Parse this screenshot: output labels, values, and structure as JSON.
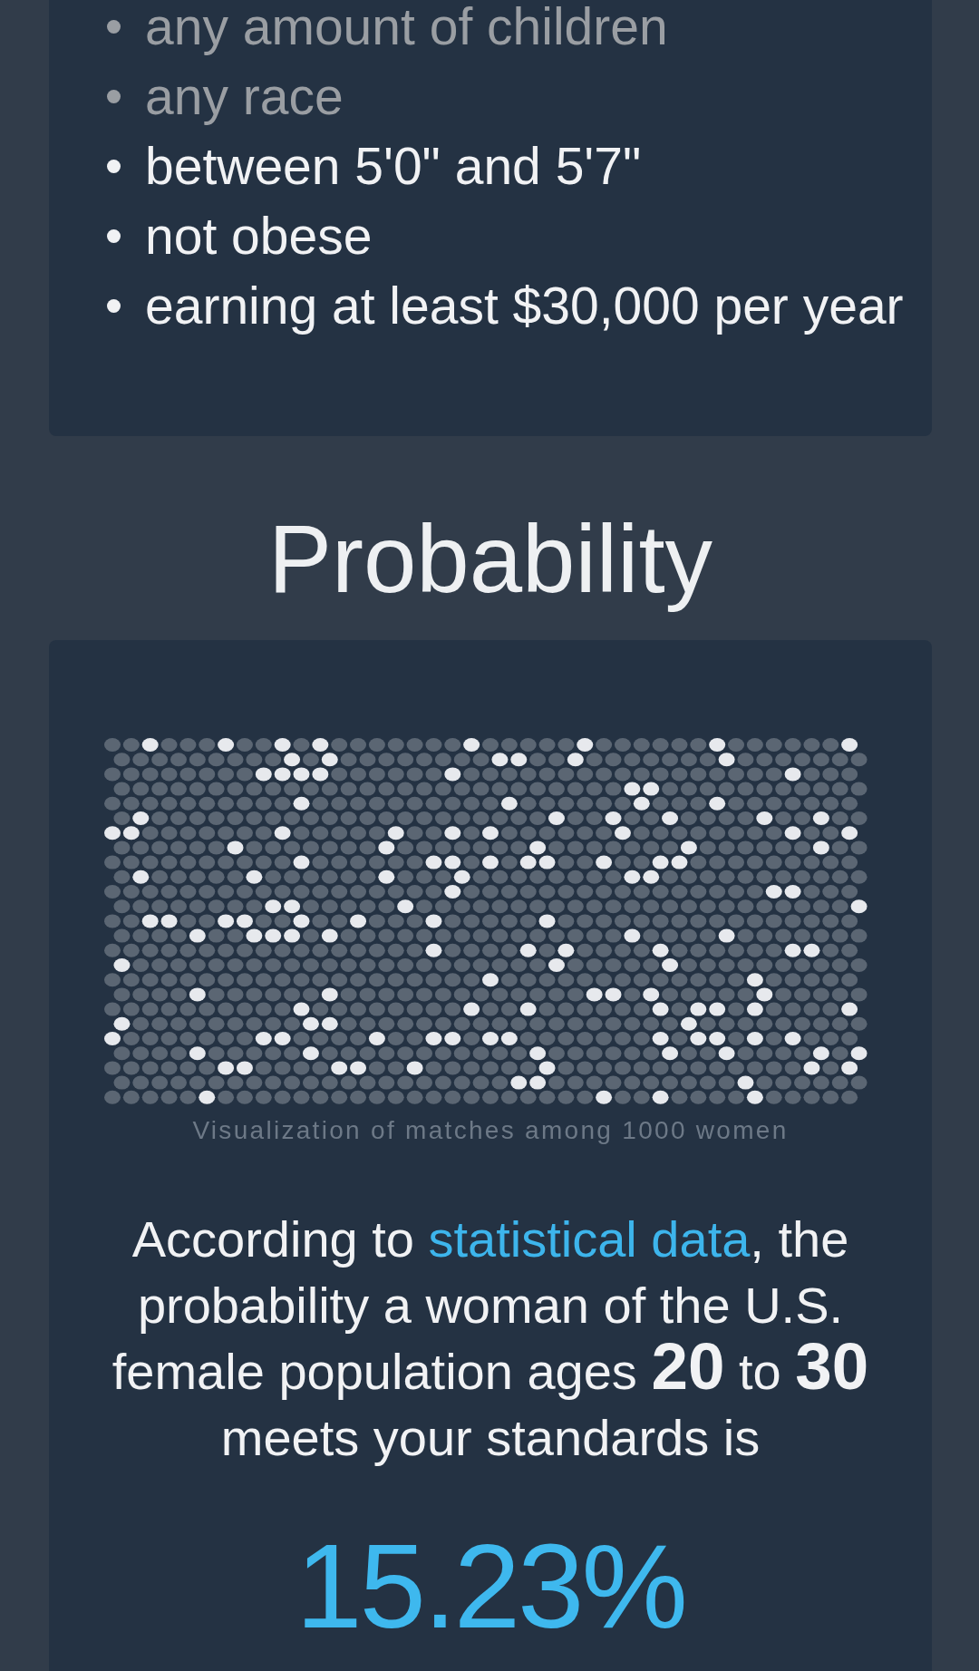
{
  "criteria": {
    "items": [
      {
        "text": "any amount of children",
        "dimmed": true
      },
      {
        "text": "any race",
        "dimmed": true
      },
      {
        "text": "between 5'0\" and 5'7\"",
        "dimmed": false
      },
      {
        "text": "not obese",
        "dimmed": false
      },
      {
        "text": "earning at least $30,000 per year",
        "dimmed": false
      }
    ]
  },
  "probability": {
    "heading": "Probability",
    "dot_rows": [
      [
        false,
        false,
        true,
        false,
        false,
        false,
        true,
        false,
        false,
        true,
        false,
        true,
        false,
        false,
        false,
        false,
        false,
        false,
        false,
        true,
        false,
        false,
        false,
        false,
        false,
        true,
        false,
        false,
        false,
        false,
        false,
        false,
        true,
        false,
        false,
        false,
        false,
        false,
        false,
        true
      ],
      [
        false,
        false,
        false,
        false,
        false,
        false,
        false,
        false,
        false,
        true,
        false,
        true,
        false,
        false,
        false,
        false,
        false,
        false,
        false,
        false,
        true,
        true,
        false,
        false,
        true,
        false,
        false,
        false,
        false,
        false,
        false,
        false,
        true,
        false,
        false,
        false,
        false,
        false,
        false,
        false
      ],
      [
        false,
        false,
        false,
        false,
        false,
        false,
        false,
        false,
        true,
        true,
        true,
        true,
        false,
        false,
        false,
        false,
        false,
        false,
        true,
        false,
        false,
        false,
        false,
        false,
        false,
        false,
        false,
        false,
        false,
        false,
        false,
        false,
        false,
        false,
        false,
        false,
        true,
        false,
        false,
        false
      ],
      [
        false,
        false,
        false,
        false,
        false,
        false,
        false,
        false,
        false,
        false,
        false,
        false,
        false,
        false,
        false,
        false,
        false,
        false,
        false,
        false,
        false,
        false,
        false,
        false,
        false,
        false,
        false,
        true,
        true,
        false,
        false,
        false,
        false,
        false,
        false,
        false,
        false,
        false,
        false,
        false
      ],
      [
        false,
        false,
        false,
        false,
        false,
        false,
        false,
        false,
        false,
        false,
        true,
        false,
        false,
        false,
        false,
        false,
        false,
        false,
        false,
        false,
        false,
        true,
        false,
        false,
        false,
        false,
        false,
        false,
        true,
        false,
        false,
        false,
        true,
        false,
        false,
        false,
        false,
        false,
        false,
        false
      ],
      [
        false,
        true,
        false,
        false,
        false,
        false,
        false,
        false,
        false,
        false,
        false,
        false,
        false,
        false,
        false,
        false,
        false,
        false,
        false,
        false,
        false,
        false,
        false,
        true,
        false,
        false,
        true,
        false,
        false,
        true,
        false,
        false,
        false,
        false,
        true,
        false,
        false,
        true,
        false,
        false
      ],
      [
        true,
        true,
        false,
        false,
        false,
        false,
        false,
        false,
        false,
        true,
        false,
        false,
        false,
        false,
        false,
        true,
        false,
        false,
        true,
        false,
        true,
        false,
        false,
        false,
        false,
        false,
        false,
        true,
        false,
        false,
        false,
        false,
        false,
        false,
        false,
        false,
        true,
        false,
        false,
        true
      ],
      [
        false,
        false,
        false,
        false,
        false,
        false,
        true,
        false,
        false,
        false,
        false,
        false,
        false,
        false,
        true,
        false,
        false,
        false,
        false,
        false,
        false,
        false,
        true,
        false,
        false,
        false,
        false,
        false,
        false,
        false,
        true,
        false,
        false,
        false,
        false,
        false,
        false,
        true,
        false,
        false
      ],
      [
        false,
        false,
        false,
        false,
        false,
        false,
        false,
        false,
        false,
        false,
        true,
        false,
        false,
        false,
        false,
        false,
        false,
        true,
        true,
        false,
        true,
        false,
        true,
        true,
        false,
        false,
        true,
        false,
        false,
        true,
        true,
        false,
        false,
        false,
        false,
        false,
        false,
        false,
        false,
        false
      ],
      [
        false,
        true,
        false,
        false,
        false,
        false,
        false,
        true,
        false,
        false,
        false,
        false,
        false,
        false,
        true,
        false,
        false,
        false,
        true,
        false,
        false,
        false,
        false,
        false,
        false,
        false,
        false,
        true,
        true,
        false,
        false,
        false,
        false,
        false,
        false,
        false,
        false,
        false,
        false,
        false
      ],
      [
        false,
        false,
        false,
        false,
        false,
        false,
        false,
        false,
        false,
        false,
        false,
        false,
        false,
        false,
        false,
        false,
        false,
        false,
        true,
        false,
        false,
        false,
        false,
        false,
        false,
        false,
        false,
        false,
        false,
        false,
        false,
        false,
        false,
        false,
        false,
        true,
        true,
        false,
        false,
        false
      ],
      [
        false,
        false,
        false,
        false,
        false,
        false,
        false,
        false,
        true,
        true,
        false,
        false,
        false,
        false,
        false,
        true,
        false,
        false,
        false,
        false,
        false,
        false,
        false,
        false,
        false,
        false,
        false,
        false,
        false,
        false,
        false,
        false,
        false,
        false,
        false,
        false,
        false,
        false,
        false,
        true
      ],
      [
        false,
        false,
        true,
        true,
        false,
        false,
        true,
        true,
        false,
        false,
        true,
        false,
        false,
        true,
        false,
        false,
        false,
        true,
        false,
        false,
        false,
        false,
        false,
        true,
        false,
        false,
        false,
        false,
        false,
        false,
        false,
        false,
        false,
        false,
        false,
        false,
        false,
        false,
        false,
        false
      ],
      [
        false,
        false,
        false,
        false,
        true,
        false,
        false,
        true,
        true,
        true,
        false,
        true,
        false,
        false,
        false,
        false,
        false,
        false,
        false,
        false,
        false,
        false,
        false,
        false,
        false,
        false,
        false,
        true,
        false,
        false,
        false,
        false,
        true,
        false,
        false,
        false,
        false,
        false,
        false,
        false
      ],
      [
        false,
        false,
        false,
        false,
        false,
        false,
        false,
        false,
        false,
        false,
        false,
        false,
        false,
        false,
        false,
        false,
        false,
        true,
        false,
        false,
        false,
        false,
        true,
        false,
        true,
        false,
        false,
        false,
        false,
        true,
        false,
        false,
        false,
        false,
        false,
        false,
        true,
        true,
        false,
        false
      ],
      [
        true,
        false,
        false,
        false,
        false,
        false,
        false,
        false,
        false,
        false,
        false,
        false,
        false,
        false,
        false,
        false,
        false,
        false,
        false,
        false,
        false,
        false,
        false,
        true,
        false,
        false,
        false,
        false,
        false,
        true,
        false,
        false,
        false,
        false,
        false,
        false,
        false,
        false,
        false,
        false
      ],
      [
        false,
        false,
        false,
        false,
        false,
        false,
        false,
        false,
        false,
        false,
        false,
        false,
        false,
        false,
        false,
        false,
        false,
        false,
        false,
        false,
        true,
        false,
        false,
        false,
        false,
        false,
        false,
        false,
        false,
        false,
        false,
        false,
        false,
        false,
        true,
        false,
        false,
        false,
        false,
        false
      ],
      [
        false,
        false,
        false,
        false,
        true,
        false,
        false,
        false,
        false,
        false,
        false,
        true,
        false,
        false,
        false,
        false,
        false,
        false,
        false,
        false,
        false,
        false,
        false,
        false,
        false,
        true,
        true,
        false,
        true,
        false,
        false,
        false,
        false,
        false,
        true,
        false,
        false,
        false,
        false,
        false
      ],
      [
        false,
        false,
        false,
        false,
        false,
        false,
        false,
        false,
        false,
        false,
        true,
        false,
        false,
        false,
        false,
        false,
        false,
        false,
        false,
        true,
        false,
        false,
        true,
        false,
        false,
        false,
        false,
        false,
        false,
        true,
        false,
        true,
        true,
        false,
        true,
        false,
        false,
        false,
        false,
        true
      ],
      [
        true,
        false,
        false,
        false,
        false,
        false,
        false,
        false,
        false,
        false,
        true,
        true,
        false,
        false,
        false,
        false,
        false,
        false,
        false,
        false,
        false,
        false,
        false,
        false,
        false,
        false,
        false,
        false,
        false,
        false,
        true,
        false,
        false,
        false,
        false,
        false,
        false,
        false,
        false,
        false
      ],
      [
        true,
        false,
        false,
        false,
        false,
        false,
        false,
        false,
        true,
        true,
        false,
        false,
        false,
        false,
        true,
        false,
        false,
        true,
        true,
        false,
        true,
        true,
        false,
        false,
        false,
        false,
        false,
        false,
        false,
        true,
        false,
        true,
        true,
        false,
        true,
        false,
        true,
        false,
        false,
        false
      ],
      [
        false,
        false,
        false,
        false,
        true,
        false,
        false,
        false,
        false,
        false,
        true,
        false,
        false,
        false,
        false,
        false,
        false,
        false,
        false,
        false,
        false,
        false,
        true,
        false,
        false,
        false,
        false,
        false,
        false,
        true,
        false,
        false,
        true,
        false,
        false,
        false,
        false,
        true,
        false,
        true
      ],
      [
        false,
        false,
        false,
        false,
        false,
        false,
        true,
        true,
        false,
        false,
        false,
        false,
        true,
        true,
        false,
        false,
        true,
        false,
        false,
        false,
        false,
        false,
        false,
        true,
        false,
        false,
        false,
        false,
        false,
        false,
        false,
        false,
        false,
        false,
        false,
        false,
        false,
        true,
        false,
        true
      ],
      [
        false,
        false,
        false,
        false,
        false,
        false,
        false,
        false,
        false,
        false,
        false,
        false,
        false,
        false,
        false,
        false,
        false,
        false,
        false,
        false,
        false,
        true,
        true,
        false,
        false,
        false,
        false,
        false,
        false,
        false,
        false,
        false,
        false,
        true,
        false,
        false,
        false,
        false,
        false,
        false
      ],
      [
        false,
        false,
        false,
        false,
        false,
        true,
        false,
        false,
        false,
        false,
        false,
        false,
        false,
        false,
        false,
        false,
        false,
        false,
        false,
        false,
        false,
        false,
        false,
        false,
        false,
        false,
        true,
        false,
        false,
        true,
        false,
        false,
        false,
        false,
        true,
        false,
        false,
        false,
        false,
        false
      ]
    ],
    "caption": "Visualization of matches among 1000 women",
    "statement": {
      "before_link": "According to ",
      "link": "statistical data",
      "after_link": ", the probability a woman of the U.S. female population ages **20** to **30** meets your standards is"
    },
    "result": "15.23%"
  }
}
